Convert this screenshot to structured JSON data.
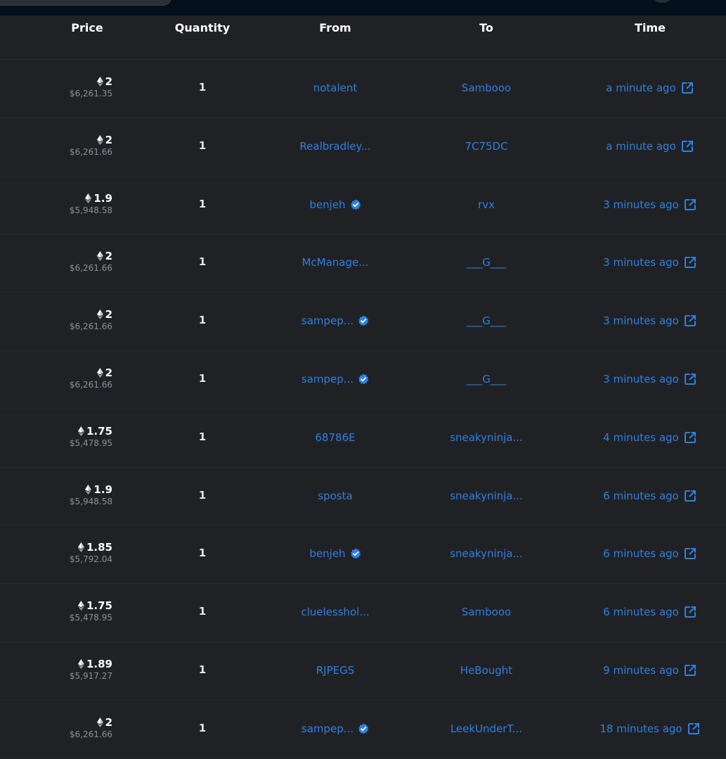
{
  "header": {
    "price": "Price",
    "quantity": "Quantity",
    "from": "From",
    "to": "To",
    "time": "Time"
  },
  "colors": {
    "link": "#2d81e2",
    "background": "#202125",
    "text": "#ffffff",
    "muted": "#8a939b"
  },
  "icons": {
    "price": "eth-icon",
    "verified": "verified-badge-icon",
    "time_link": "external-link-icon"
  },
  "rows": [
    {
      "eth": "2",
      "usd": "$6,261.35",
      "qty": "1",
      "from": "notalent",
      "from_verified": false,
      "to": "Sambooo",
      "time": "a minute ago"
    },
    {
      "eth": "2",
      "usd": "$6,261.66",
      "qty": "1",
      "from": "Realbradley...",
      "from_verified": false,
      "to": "7C75DC",
      "time": "a minute ago"
    },
    {
      "eth": "1.9",
      "usd": "$5,948.58",
      "qty": "1",
      "from": "benjeh",
      "from_verified": true,
      "to": "rvx",
      "time": "3 minutes ago"
    },
    {
      "eth": "2",
      "usd": "$6,261.66",
      "qty": "1",
      "from": "McManage...",
      "from_verified": false,
      "to": "___G___",
      "time": "3 minutes ago"
    },
    {
      "eth": "2",
      "usd": "$6,261.66",
      "qty": "1",
      "from": "sampep...",
      "from_verified": true,
      "to": "___G___",
      "time": "3 minutes ago"
    },
    {
      "eth": "2",
      "usd": "$6,261.66",
      "qty": "1",
      "from": "sampep...",
      "from_verified": true,
      "to": "___G___",
      "time": "3 minutes ago"
    },
    {
      "eth": "1.75",
      "usd": "$5,478.95",
      "qty": "1",
      "from": "68786E",
      "from_verified": false,
      "to": "sneakyninja...",
      "time": "4 minutes ago"
    },
    {
      "eth": "1.9",
      "usd": "$5,948.58",
      "qty": "1",
      "from": "sposta",
      "from_verified": false,
      "to": "sneakyninja...",
      "time": "6 minutes ago"
    },
    {
      "eth": "1.85",
      "usd": "$5,792.04",
      "qty": "1",
      "from": "benjeh",
      "from_verified": true,
      "to": "sneakyninja...",
      "time": "6 minutes ago"
    },
    {
      "eth": "1.75",
      "usd": "$5,478.95",
      "qty": "1",
      "from": "cluelesshol...",
      "from_verified": false,
      "to": "Sambooo",
      "time": "6 minutes ago"
    },
    {
      "eth": "1.89",
      "usd": "$5,917.27",
      "qty": "1",
      "from": "RJPEGS",
      "from_verified": false,
      "to": "HeBought",
      "time": "9 minutes ago"
    },
    {
      "eth": "2",
      "usd": "$6,261.66",
      "qty": "1",
      "from": "sampep...",
      "from_verified": true,
      "to": "LeekUnderT...",
      "time": "18 minutes ago"
    }
  ]
}
